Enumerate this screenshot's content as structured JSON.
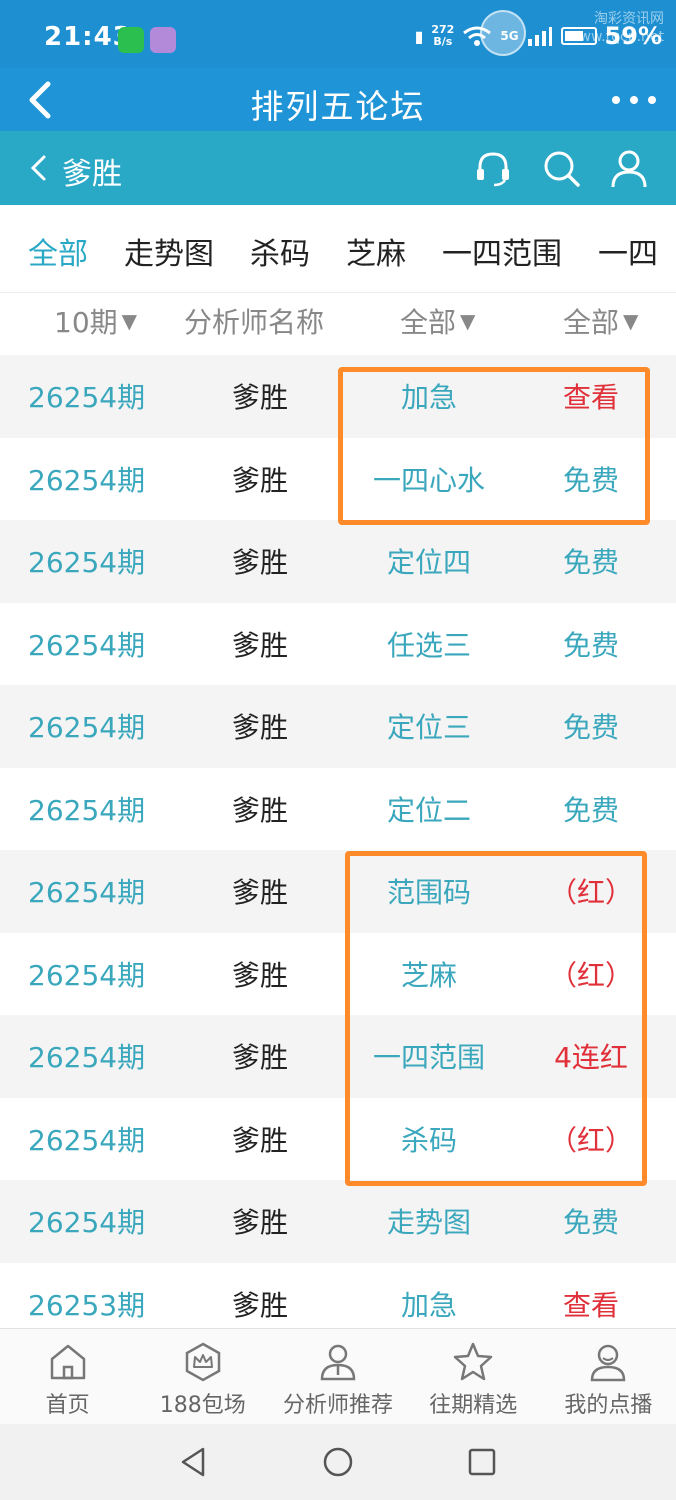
{
  "status_bar": {
    "time": "21:43",
    "net_speed_value": "272",
    "net_speed_unit": "B/s",
    "signal": "5G",
    "battery": "59%",
    "watermark_line1": "淘彩资讯网",
    "watermark_line2": "www.tqcp.net"
  },
  "title_bar": {
    "title": "排列五论坛"
  },
  "sub_header": {
    "title": "爹胜"
  },
  "tabs": [
    {
      "label": "全部",
      "active": true
    },
    {
      "label": "走势图",
      "active": false
    },
    {
      "label": "杀码",
      "active": false
    },
    {
      "label": "芝麻",
      "active": false
    },
    {
      "label": "一四范围",
      "active": false
    },
    {
      "label": "一四",
      "active": false
    }
  ],
  "filters": {
    "periods": "10期",
    "analyst": "分析师名称",
    "type": "全部",
    "status": "全部",
    "caret": "▼"
  },
  "rows": [
    {
      "period": "26254期",
      "name": "爹胜",
      "type": "加急",
      "status": "查看",
      "status_color": "red"
    },
    {
      "period": "26254期",
      "name": "爹胜",
      "type": "一四心水",
      "status": "免费",
      "status_color": "teal"
    },
    {
      "period": "26254期",
      "name": "爹胜",
      "type": "定位四",
      "status": "免费",
      "status_color": "teal"
    },
    {
      "period": "26254期",
      "name": "爹胜",
      "type": "任选三",
      "status": "免费",
      "status_color": "teal"
    },
    {
      "period": "26254期",
      "name": "爹胜",
      "type": "定位三",
      "status": "免费",
      "status_color": "teal"
    },
    {
      "period": "26254期",
      "name": "爹胜",
      "type": "定位二",
      "status": "免费",
      "status_color": "teal"
    },
    {
      "period": "26254期",
      "name": "爹胜",
      "type": "范围码",
      "status": "（红）",
      "status_color": "red"
    },
    {
      "period": "26254期",
      "name": "爹胜",
      "type": "芝麻",
      "status": "（红）",
      "status_color": "red"
    },
    {
      "period": "26254期",
      "name": "爹胜",
      "type": "一四范围",
      "status": "4连红",
      "status_color": "red"
    },
    {
      "period": "26254期",
      "name": "爹胜",
      "type": "杀码",
      "status": "（红）",
      "status_color": "red"
    },
    {
      "period": "26254期",
      "name": "爹胜",
      "type": "走势图",
      "status": "免费",
      "status_color": "teal"
    },
    {
      "period": "26253期",
      "name": "爹胜",
      "type": "加急",
      "status": "查看",
      "status_color": "red"
    }
  ],
  "bottom_nav": [
    {
      "label": "首页",
      "icon": "home-icon"
    },
    {
      "label": "188包场",
      "icon": "crown-icon"
    },
    {
      "label": "分析师推荐",
      "icon": "analyst-icon"
    },
    {
      "label": "往期精选",
      "icon": "star-icon"
    },
    {
      "label": "我的点播",
      "icon": "profile-icon"
    }
  ],
  "colors": {
    "accent": "#2aa9c6",
    "title_bar": "#1f94d6",
    "highlight": "#ff8a2a",
    "red": "#e0303a"
  }
}
